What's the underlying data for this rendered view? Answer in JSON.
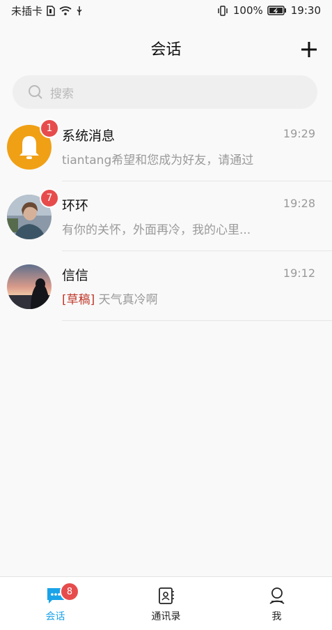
{
  "status_bar": {
    "carrier": "未插卡",
    "battery": "100%",
    "time": "19:30"
  },
  "header": {
    "title": "会话",
    "add_icon": "plus-icon"
  },
  "search": {
    "placeholder": "搜索",
    "icon": "search-icon"
  },
  "conversations": [
    {
      "name": "系统消息",
      "time": "19:29",
      "preview": "tiantang希望和您成为好友，请通过",
      "unread": "1",
      "avatar": "bell-avatar"
    },
    {
      "name": "环环",
      "time": "19:28",
      "preview": "有你的关怀，外面再冷，我的心里...",
      "unread": "7",
      "avatar": "photo-avatar"
    },
    {
      "name": "信信",
      "time": "19:12",
      "draft_tag": "[草稿]",
      "preview": "天气真冷啊",
      "unread": "",
      "avatar": "photo-avatar"
    }
  ],
  "tabs": [
    {
      "label": "会话",
      "icon": "chat-bubble-icon",
      "badge": "8",
      "active": true
    },
    {
      "label": "通讯录",
      "icon": "contacts-book-icon"
    },
    {
      "label": "我",
      "icon": "person-icon"
    }
  ],
  "colors": {
    "accent": "#1aa3e8",
    "badge": "#e74c4c",
    "draft": "#c0392b",
    "bell_avatar": "#f0a015"
  }
}
